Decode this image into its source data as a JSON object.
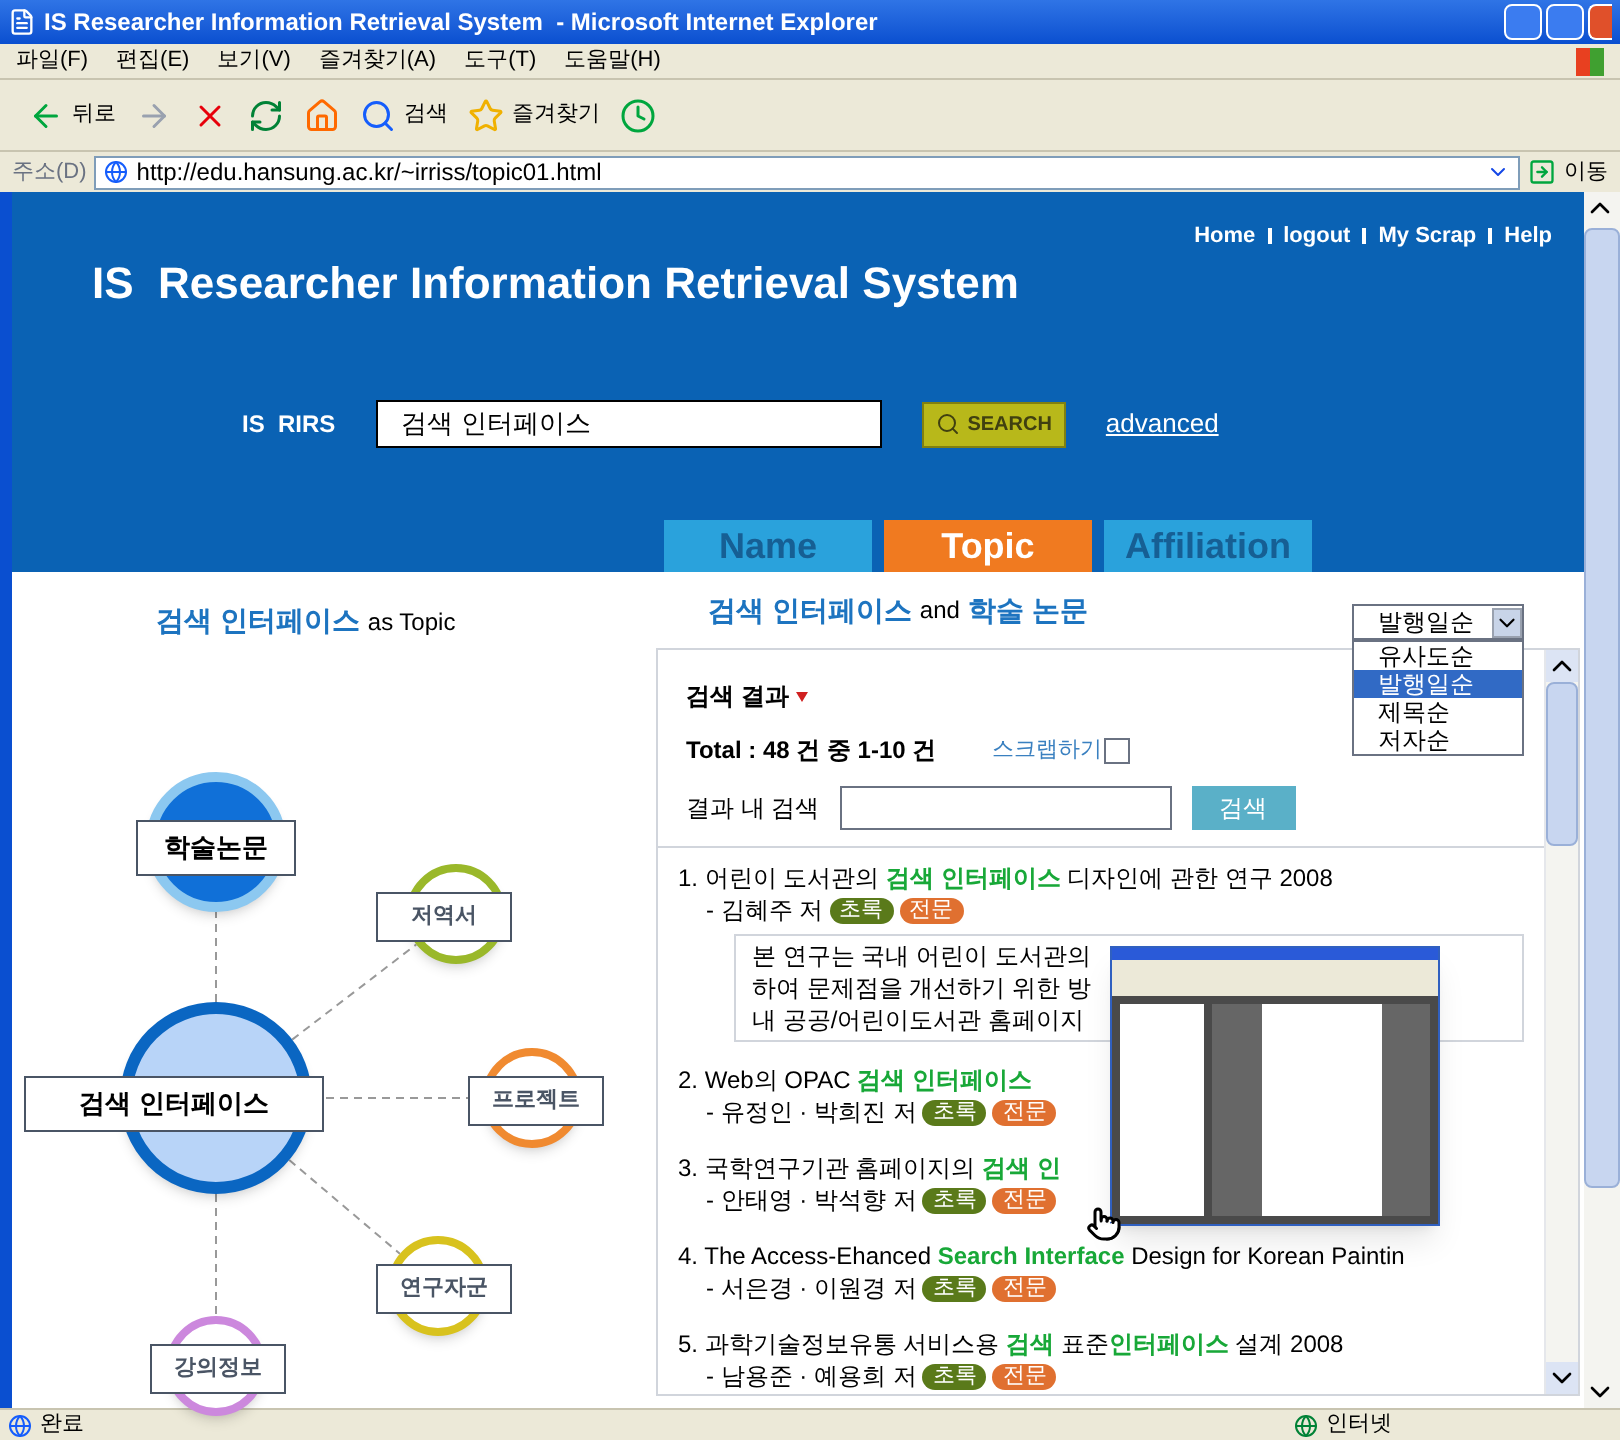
{
  "window": {
    "title": "IS Researcher Information Retrieval System  - Microsoft Internet Explorer"
  },
  "menu": [
    "파일(F)",
    "편집(E)",
    "보기(V)",
    "즐겨찾기(A)",
    "도구(T)",
    "도움말(H)"
  ],
  "toolbar": [
    {
      "kind": "back",
      "label": "뒤로"
    },
    {
      "kind": "forward"
    },
    {
      "kind": "stop"
    },
    {
      "kind": "refresh"
    },
    {
      "kind": "home"
    },
    {
      "kind": "search",
      "label": "검색"
    },
    {
      "kind": "favorites",
      "label": "즐겨찾기"
    },
    {
      "kind": "history"
    }
  ],
  "address": {
    "label": "주소(D)",
    "url": "http://edu.hansung.ac.kr/~irriss/topic01.html",
    "go": "이동"
  },
  "site": {
    "title": "IS  Researcher Information Retrieval System",
    "links": [
      "Home",
      "logout",
      "My Scrap",
      "Help"
    ],
    "search_label": "IS  RIRS",
    "query": "검색 인터페이스",
    "search_button": "SEARCH",
    "advanced": "advanced"
  },
  "tabs": [
    {
      "label": "Name",
      "selected": false
    },
    {
      "label": "Topic",
      "selected": true
    },
    {
      "label": "Affiliation",
      "selected": false
    }
  ],
  "topic_map": {
    "term": "검색 인터페이스",
    "suffix": "as Topic",
    "nodes": [
      {
        "label": "학술논문",
        "kind": "primary",
        "color": "#1070d8"
      },
      {
        "label": "저역서",
        "kind": "related",
        "color": "#9ab82a"
      },
      {
        "label": "검색 인터페이스",
        "kind": "center",
        "color": "#0a66c2"
      },
      {
        "label": "프로젝트",
        "kind": "related",
        "color": "#f08a30"
      },
      {
        "label": "연구자군",
        "kind": "related",
        "color": "#d8c21e"
      },
      {
        "label": "강의정보",
        "kind": "related",
        "color": "#cc88dd"
      }
    ]
  },
  "results_heading": {
    "term": "검색 인터페이스",
    "joiner": "and",
    "category": "학술 논문"
  },
  "sort": {
    "value": "발행일순",
    "expanded": true,
    "options": [
      {
        "label": "유사도순",
        "selected": false
      },
      {
        "label": "발행일순",
        "selected": true
      },
      {
        "label": "제목순",
        "selected": false
      },
      {
        "label": "저자순",
        "selected": false
      }
    ]
  },
  "results": {
    "title": "검색 결과",
    "total": "Total : 48 건 중 1-10 건",
    "scrap": {
      "label": "스크랩하기",
      "checked": false
    },
    "within_label": "결과 내 검색",
    "within_button": "검색",
    "items": [
      {
        "title": [
          {
            "text": "1. 어린이 도서관의 ",
            "highlight": false
          },
          {
            "text": "검색 인터페이스",
            "highlight": true
          },
          {
            "text": " 디자인에 관한 연구  2008",
            "highlight": false
          }
        ],
        "authors": "- 김혜주 저",
        "abstract_button": "초록",
        "full_button": "전문",
        "abstract": [
          "본 연구는 국내 어린이 도서관의",
          "하여 문제점을 개선하기 위한 방",
          "내 공공/어린이도서관 홈페이지"
        ]
      },
      {
        "title": [
          {
            "text": "2. Web의 OPAC ",
            "highlight": false
          },
          {
            "text": "검색 인터페이스",
            "highlight": true
          }
        ],
        "authors": "- 유정인 · 박희진 저",
        "abstract_button": "초록",
        "full_button": "전문"
      },
      {
        "title": [
          {
            "text": "3. 국학연구기관 홈페이지의 ",
            "highlight": false
          },
          {
            "text": "검색 인",
            "highlight": true
          }
        ],
        "authors": "- 안태영 · 박석향 저",
        "abstract_button": "초록",
        "full_button": "전문"
      },
      {
        "title": [
          {
            "text": "4. The Access-Ehanced ",
            "highlight": false
          },
          {
            "text": "Search Interface",
            "highlight": true
          },
          {
            "text": " Design for Korean Paintin",
            "highlight": false
          }
        ],
        "authors": "- 서은경 · 이원경 저",
        "abstract_button": "초록",
        "full_button": "전문"
      },
      {
        "title": [
          {
            "text": "5. 과학기술정보유통 서비스용 ",
            "highlight": false
          },
          {
            "text": "검색",
            "highlight": true
          },
          {
            "text": " 표준",
            "highlight": false
          },
          {
            "text": "인터페이스",
            "highlight": true
          },
          {
            "text": " 설계  2008",
            "highlight": false
          }
        ],
        "authors": "- 남용준 · 예용희 저",
        "abstract_button": "초록",
        "full_button": "전문"
      }
    ]
  },
  "status_bar": {
    "text": "완료",
    "zone": "인터넷"
  }
}
